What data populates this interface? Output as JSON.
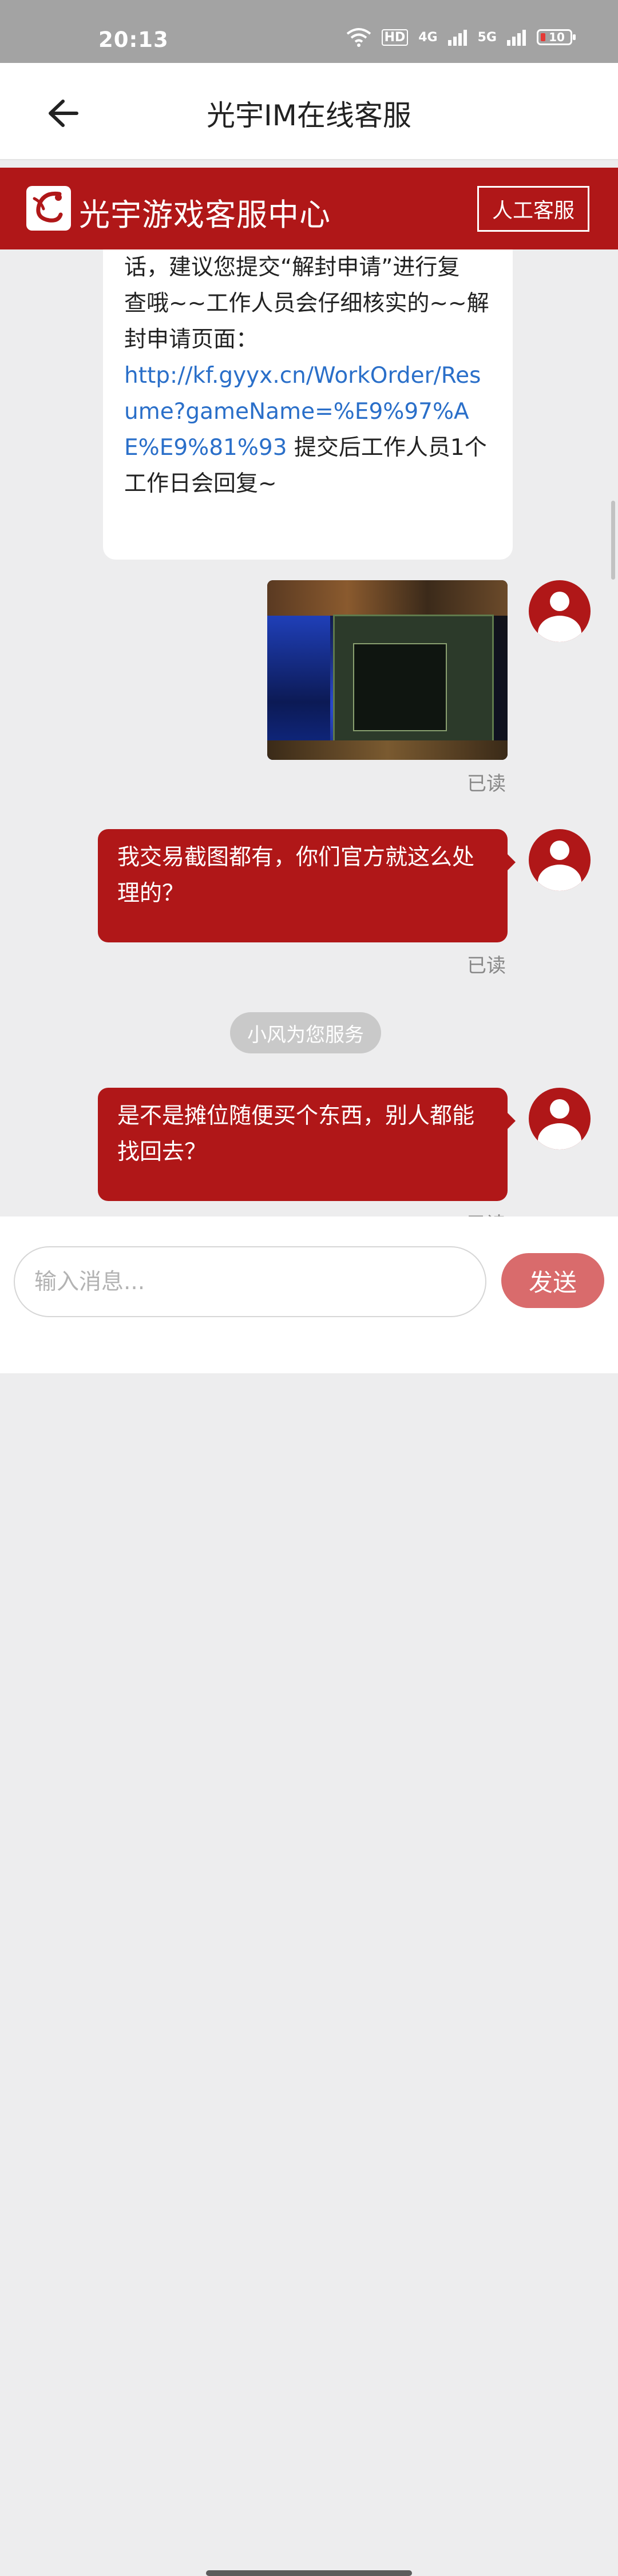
{
  "status_bar": {
    "time": "20:13",
    "hd_label": "HD",
    "net_4g": "4G",
    "net_5g": "5G",
    "battery": "10"
  },
  "header": {
    "title": "光宇IM在线客服"
  },
  "banner": {
    "title": "光宇游戏客服中心",
    "human_service_label": "人工客服"
  },
  "messages": {
    "agent_1": {
      "line_partial": "话，建议您提交“解封申请”进行复",
      "text_1": "查哦~~工作人员会仔细核实的~~解封申请页面：",
      "link": "http://kf.gyyx.cn/WorkOrder/Resume?gameName=%E9%97%AE%E9%81%93",
      "text_2": " 提交后工作人员1个工作日会回复~"
    },
    "user_image_read": "已读",
    "user_1": {
      "text": "我交易截图都有，你们官方就这么处理的？",
      "read": "已读"
    },
    "service_notice": "小风为您服务",
    "user_2": {
      "text": "是不是摊位随便买个东西，别人都能找回去？",
      "read": "已读"
    }
  },
  "input": {
    "placeholder": "输入消息...",
    "value": ""
  },
  "send_label": "发送",
  "colors": {
    "brand_red": "#b01718",
    "send_button": "#d96b6c",
    "link": "#2a6fc9"
  }
}
